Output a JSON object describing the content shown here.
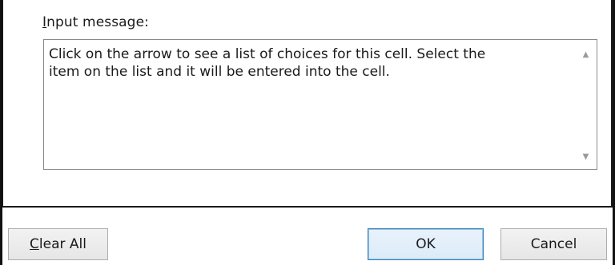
{
  "input_message": {
    "label_mnemonic": "I",
    "label_rest": "nput message:",
    "text": "Click on the arrow to see a list of choices for this cell. Select the\nitem on the list and it will be entered into the cell.",
    "scroll_up_icon": "triangle-up",
    "scroll_down_icon": "triangle-down"
  },
  "buttons": {
    "clear_all_mnemonic": "C",
    "clear_all_rest": "lear All",
    "ok": "OK",
    "cancel": "Cancel"
  },
  "colors": {
    "ok_border": "#3c7fb1",
    "button_border": "#adadad"
  }
}
